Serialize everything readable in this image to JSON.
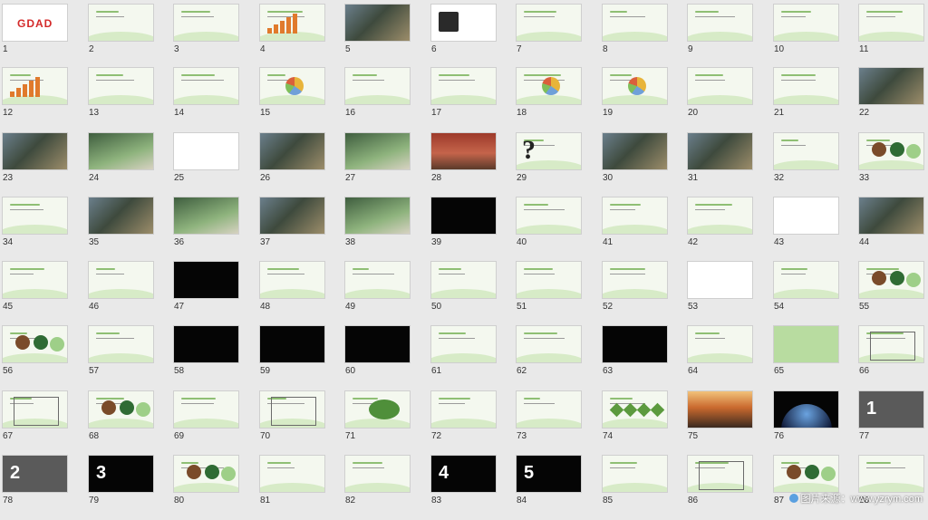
{
  "slides": [
    {
      "n": "1",
      "style": "logo",
      "label": "GDAD"
    },
    {
      "n": "2",
      "style": "title"
    },
    {
      "n": "3",
      "style": "title"
    },
    {
      "n": "4",
      "style": "bars"
    },
    {
      "n": "5",
      "style": "photo"
    },
    {
      "n": "6",
      "style": "red-chart"
    },
    {
      "n": "7",
      "style": "title"
    },
    {
      "n": "8",
      "style": "title"
    },
    {
      "n": "9",
      "style": "title"
    },
    {
      "n": "10",
      "style": "title"
    },
    {
      "n": "11",
      "style": "title"
    },
    {
      "n": "12",
      "style": "bars"
    },
    {
      "n": "13",
      "style": "title"
    },
    {
      "n": "14",
      "style": "title"
    },
    {
      "n": "15",
      "style": "pie"
    },
    {
      "n": "16",
      "style": "title"
    },
    {
      "n": "17",
      "style": "title"
    },
    {
      "n": "18",
      "style": "pie"
    },
    {
      "n": "19",
      "style": "pie"
    },
    {
      "n": "20",
      "style": "title"
    },
    {
      "n": "21",
      "style": "title"
    },
    {
      "n": "22",
      "style": "photo"
    },
    {
      "n": "23",
      "style": "photo"
    },
    {
      "n": "24",
      "style": "photo2"
    },
    {
      "n": "25",
      "style": "white"
    },
    {
      "n": "26",
      "style": "photo"
    },
    {
      "n": "27",
      "style": "photo2"
    },
    {
      "n": "28",
      "style": "red"
    },
    {
      "n": "29",
      "style": "qm"
    },
    {
      "n": "30",
      "style": "photo"
    },
    {
      "n": "31",
      "style": "photo"
    },
    {
      "n": "32",
      "style": "title"
    },
    {
      "n": "33",
      "style": "circles"
    },
    {
      "n": "34",
      "style": "title"
    },
    {
      "n": "35",
      "style": "photo"
    },
    {
      "n": "36",
      "style": "photo2"
    },
    {
      "n": "37",
      "style": "photo"
    },
    {
      "n": "38",
      "style": "photo2"
    },
    {
      "n": "39",
      "style": "black"
    },
    {
      "n": "40",
      "style": "title"
    },
    {
      "n": "41",
      "style": "title"
    },
    {
      "n": "42",
      "style": "title"
    },
    {
      "n": "43",
      "style": "white"
    },
    {
      "n": "44",
      "style": "photo"
    },
    {
      "n": "45",
      "style": "title"
    },
    {
      "n": "46",
      "style": "title"
    },
    {
      "n": "47",
      "style": "black"
    },
    {
      "n": "48",
      "style": "title"
    },
    {
      "n": "49",
      "style": "title"
    },
    {
      "n": "50",
      "style": "title"
    },
    {
      "n": "51",
      "style": "title"
    },
    {
      "n": "52",
      "style": "title"
    },
    {
      "n": "53",
      "style": "white"
    },
    {
      "n": "54",
      "style": "title"
    },
    {
      "n": "55",
      "style": "circles"
    },
    {
      "n": "56",
      "style": "circles"
    },
    {
      "n": "57",
      "style": "title"
    },
    {
      "n": "58",
      "style": "black"
    },
    {
      "n": "59",
      "style": "black"
    },
    {
      "n": "60",
      "style": "black"
    },
    {
      "n": "61",
      "style": "title"
    },
    {
      "n": "62",
      "style": "title"
    },
    {
      "n": "63",
      "style": "black"
    },
    {
      "n": "64",
      "style": "title"
    },
    {
      "n": "65",
      "style": "green"
    },
    {
      "n": "66",
      "style": "oct"
    },
    {
      "n": "67",
      "style": "oct"
    },
    {
      "n": "68",
      "style": "circles"
    },
    {
      "n": "69",
      "style": "title"
    },
    {
      "n": "70",
      "style": "oct"
    },
    {
      "n": "71",
      "style": "oval"
    },
    {
      "n": "72",
      "style": "title"
    },
    {
      "n": "73",
      "style": "title"
    },
    {
      "n": "74",
      "style": "diamonds"
    },
    {
      "n": "75",
      "style": "sunset"
    },
    {
      "n": "76",
      "style": "moon"
    },
    {
      "n": "77",
      "style": "gray",
      "big": "1"
    },
    {
      "n": "78",
      "style": "gray",
      "big": "2"
    },
    {
      "n": "79",
      "style": "black",
      "big": "3"
    },
    {
      "n": "80",
      "style": "circles"
    },
    {
      "n": "81",
      "style": "title"
    },
    {
      "n": "82",
      "style": "title"
    },
    {
      "n": "83",
      "style": "black",
      "big": "4"
    },
    {
      "n": "84",
      "style": "black",
      "big": "5"
    },
    {
      "n": "85",
      "style": "title"
    },
    {
      "n": "86",
      "style": "oct"
    },
    {
      "n": "87",
      "style": "circles"
    },
    {
      "n": "88",
      "style": "title"
    }
  ],
  "watermark": "图片来源：www.yzrym.com"
}
